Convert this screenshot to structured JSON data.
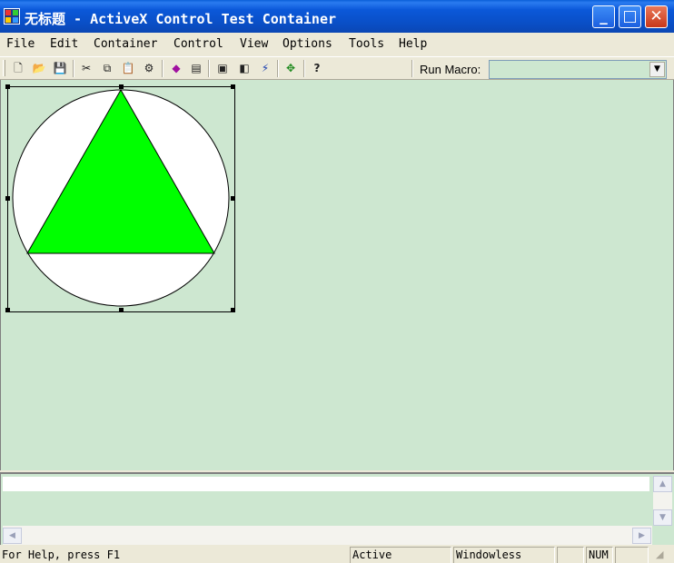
{
  "window": {
    "title": "无标题 - ActiveX Control Test Container",
    "minimize_glyph": "_",
    "maximize_glyph": "□",
    "close_glyph": "✕"
  },
  "menu": [
    {
      "label": "File"
    },
    {
      "label": "Edit"
    },
    {
      "label": "Container"
    },
    {
      "label": "Control"
    },
    {
      "label": "View"
    },
    {
      "label": "Options"
    },
    {
      "label": "Tools"
    },
    {
      "label": "Help"
    }
  ],
  "toolbar": {
    "tools": [
      {
        "name": "new-icon",
        "glyph": "🗋"
      },
      {
        "name": "open-icon",
        "glyph": "📂"
      },
      {
        "name": "save-icon",
        "glyph": "💾"
      },
      {
        "name": "cut-icon",
        "glyph": "✂"
      },
      {
        "name": "copy-icon",
        "glyph": "⧉"
      },
      {
        "name": "paste-icon",
        "glyph": "📋"
      },
      {
        "name": "properties-icon",
        "glyph": "⚙"
      },
      {
        "name": "insert-control-icon",
        "glyph": "◆"
      },
      {
        "name": "edit-properties-icon",
        "glyph": "▤"
      },
      {
        "name": "invoke-methods-icon",
        "glyph": "▣"
      },
      {
        "name": "log-icon",
        "glyph": "◧"
      },
      {
        "name": "events-icon",
        "glyph": "⚡"
      },
      {
        "name": "ambient-properties-icon",
        "glyph": "✥"
      },
      {
        "name": "help-icon",
        "glyph": "?"
      }
    ],
    "macro_label": "Run Macro:",
    "macro_value": ""
  },
  "control": {
    "circle_fill": "#ffffff",
    "triangle_fill": "#00ff00"
  },
  "status": {
    "help_text": "For Help, press F1",
    "panes": [
      "Active",
      "Windowless",
      "",
      "NUM",
      ""
    ]
  }
}
